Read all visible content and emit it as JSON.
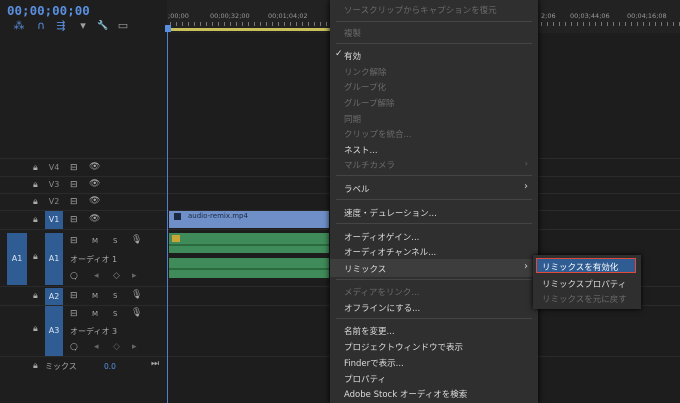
{
  "timecode": "00;00;00;00",
  "toolbar": {
    "tools": [
      {
        "name": "snap-tool-icon",
        "glyph": "⁂"
      },
      {
        "name": "magnet-icon",
        "glyph": "∩"
      },
      {
        "name": "linked-selection-icon",
        "glyph": "⇶"
      },
      {
        "name": "marker-icon",
        "glyph": "▾"
      },
      {
        "name": "wrench-icon",
        "glyph": "🔧"
      },
      {
        "name": "captions-icon",
        "glyph": "▭"
      }
    ]
  },
  "ruler": {
    "ticks_left": [
      ";00;00",
      "00;00;32;00",
      "00;01;04;02"
    ],
    "ticks_right": [
      "2;06",
      "00;03;44;06",
      "00;04;16;08"
    ]
  },
  "tracks": {
    "video": [
      {
        "label": "V4",
        "selected": false
      },
      {
        "label": "V3",
        "selected": false
      },
      {
        "label": "V2",
        "selected": false
      },
      {
        "label": "V1",
        "selected": true
      }
    ],
    "audio": [
      {
        "label": "A1",
        "source": "A1",
        "name": "オーディオ 1",
        "m": "M",
        "s": "S"
      },
      {
        "label": "A2",
        "m": "M",
        "s": "S"
      },
      {
        "label": "A3",
        "name": "オーディオ 3",
        "m": "M",
        "s": "S"
      }
    ],
    "mix_label": "ミックス",
    "mix_value": "0.0"
  },
  "clip": {
    "video_name": "audio-remix.mp4"
  },
  "menu": {
    "items": [
      {
        "label": "ソースクリップからキャプションを復元",
        "disabled": true
      },
      {
        "label": "複製",
        "disabled": true
      },
      {
        "label": "有効",
        "checked": true
      },
      {
        "label": "リンク解除",
        "disabled": true
      },
      {
        "label": "グループ化",
        "disabled": true
      },
      {
        "label": "グループ解除",
        "disabled": true
      },
      {
        "label": "同期",
        "disabled": true
      },
      {
        "label": "クリップを統合...",
        "disabled": true
      },
      {
        "label": "ネスト..."
      },
      {
        "label": "マルチカメラ",
        "disabled": true,
        "submenu": true
      },
      {
        "label": "ラベル",
        "submenu": true
      },
      {
        "label": "速度・デュレーション..."
      },
      {
        "label": "オーディオゲイン..."
      },
      {
        "label": "オーディオチャンネル..."
      },
      {
        "label": "リミックス",
        "submenu": true,
        "highlighted": true
      },
      {
        "label": "メディアをリンク...",
        "disabled": true
      },
      {
        "label": "オフラインにする..."
      },
      {
        "label": "名前を変更..."
      },
      {
        "label": "プロジェクトウィンドウで表示"
      },
      {
        "label": "Finderで表示..."
      },
      {
        "label": "プロパティ"
      },
      {
        "label": "Adobe Stock オーディオを検索"
      }
    ]
  },
  "submenu": {
    "items": [
      {
        "label": "リミックスを有効化",
        "highlighted": true
      },
      {
        "label": "リミックスプロパティ"
      },
      {
        "label": "リミックスを元に戻す",
        "disabled": true
      }
    ]
  },
  "colors": {
    "accent": "#2f5c93",
    "highlight_border": "#e04a3a",
    "audio_clip": "#3f8b59",
    "video_clip": "#6e8fc8"
  }
}
